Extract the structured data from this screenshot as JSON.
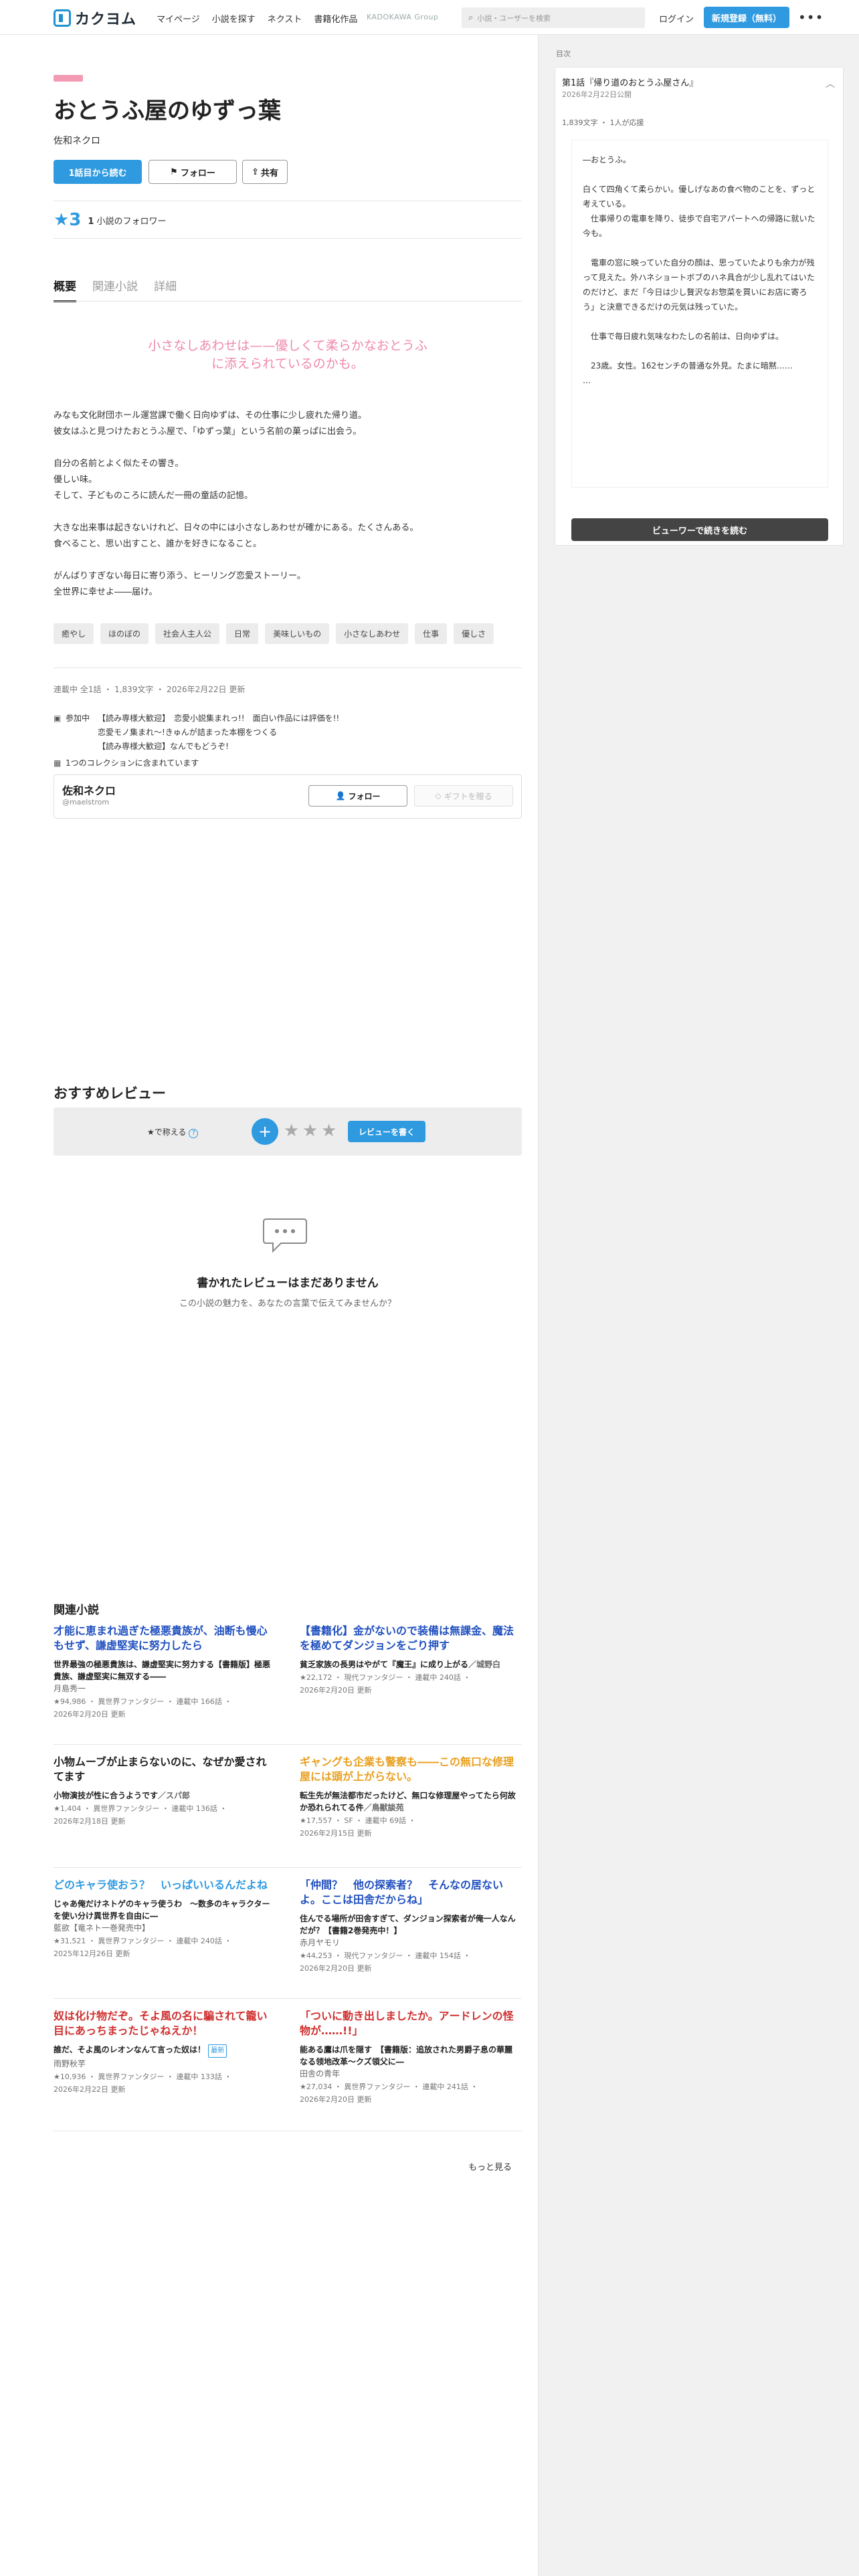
{
  "header": {
    "logo_text": "カクヨム",
    "nav": [
      "マイページ",
      "小説を探す",
      "ネクスト",
      "書籍化作品"
    ],
    "kadokawa": "KADOKAWA Group",
    "search_placeholder": "小説・ユーザーを検索",
    "login": "ログイン",
    "signup": "新規登録（無料）",
    "more": "•••"
  },
  "work": {
    "title": "おとうふ屋のゆずっ葉",
    "author": "佐和ネクロ",
    "read_btn": "1話目から読む",
    "follow_btn": "フォロー",
    "share_btn": "共有",
    "stars": "★3",
    "follower_count": "1",
    "follower_label": "小説のフォロワー"
  },
  "tabs": [
    "概要",
    "関連小説",
    "詳細"
  ],
  "catch": [
    "小さなしあわせは——優しくて柔らかなおとうふ",
    "に添えられているのかも。"
  ],
  "intro": [
    "みなも文化財団ホール運営課で働く日向ゆずは、その仕事に少し疲れた帰り道。",
    "彼女はふと見つけたおとうふ屋で、「ゆずっ葉」という名前の菓っぱに出会う。",
    "",
    "自分の名前とよく似たその響き。",
    "優しい味。",
    "そして、子どものころに読んだ一冊の童話の記憶。",
    "",
    "大きな出来事は起きないけれど、日々の中には小さなしあわせが確かにある。たくさんある。",
    "食べること、思い出すこと、誰かを好きになること。",
    "",
    "がんばりすぎない毎日に寄り添う、ヒーリング恋愛ストーリー。",
    "全世界に幸せよ――届け。"
  ],
  "tags": [
    "癒やし",
    "ほのぼの",
    "社会人主人公",
    "日常",
    "美味しいもの",
    "小さなしあわせ",
    "仕事",
    "優しさ"
  ],
  "meta": "連載中 全1話 ・ 1,839文字 ・ 2026年2月22日 更新",
  "events": {
    "label": "参加中",
    "items": [
      "【読み専様大歓迎】　恋愛小説集まれっ!!　面白い作品には評価を!!",
      "恋愛モノ集まれ〜!きゅんが詰まった本棚をつくる",
      "【読み専様大歓迎】なんでもどうぞ!"
    ]
  },
  "collection": "1つのコレクションに含まれています",
  "author_box": {
    "name": "佐和ネクロ",
    "id": "@maelstrom",
    "follow": "フォロー",
    "gift": "ギフトを贈る"
  },
  "reviews": {
    "heading": "おすすめレビュー",
    "rate_label": "★で称える",
    "write_btn": "レビューを書く",
    "empty_title": "書かれたレビューはまだありません",
    "empty_sub": "この小説の魅力を、あなたの言葉で伝えてみませんか？"
  },
  "related": {
    "heading": "関連小説",
    "more": "もっと見る",
    "items": [
      {
        "title": "才能に恵まれ過ぎた極悪貴族が、油断も慢心もせず、謙虚堅実に努力したら",
        "color": "#1f4fbf",
        "catch": "世界最強の極悪貴族は、謙虚堅実に努力する【書籍版】極悪貴族、謙虚堅実に無双する――",
        "author": "月島秀一",
        "meta1": "★94,986 ・ 異世界ファンタジー ・ 連載中 166話 ・",
        "meta2": "2026年2月20日 更新",
        "badge": ""
      },
      {
        "title": "【書籍化】金がないので装備は無課金、魔法を極めてダンジョンをごり押す",
        "color": "#1f4fbf",
        "catch": "貧乏家族の長男はやがて『魔王』に成り上がる",
        "author": "／城野白",
        "meta1": "★22,172 ・ 現代ファンタジー ・ 連載中 240話 ・",
        "meta2": "2026年2月20日 更新",
        "badge": ""
      },
      {
        "title": "小物ムーブが止まらないのに、なぜか愛されてます",
        "color": "#222222",
        "catch": "小物演技が性に合うようです",
        "author": "／スパ郎",
        "meta1": "★1,404 ・ 異世界ファンタジー ・ 連載中 136話 ・",
        "meta2": "2026年2月18日 更新",
        "badge": ""
      },
      {
        "title": "ギャングも企業も警察も――この無口な修理屋には頭が上がらない。",
        "color": "#e8a020",
        "catch": "転生先が無法都市だったけど、無口な修理屋やってたら何故か恐れられてる件",
        "author": "／鳥獣談苑",
        "meta1": "★17,557 ・ SF ・ 連載中 69話 ・",
        "meta2": "2026年2月15日 更新",
        "badge": ""
      },
      {
        "title": "どのキャラ使おう？　いっぱいいるんだよね",
        "color": "#2f9ae0",
        "catch": "じゃあ俺だけネトゲのキャラ使うわ　〜数多のキャラクターを使い分け異世界を自由に―",
        "author": "藍欲【竜ネト一巻発売中】",
        "meta1": "★31,521 ・ 異世界ファンタジー ・ 連載中 240話 ・",
        "meta2": "2025年12月26日 更新",
        "badge": ""
      },
      {
        "title": "「仲間？　他の探索者？　そんなの居ないよ。ここは田舎だからね」",
        "color": "#1f4fbf",
        "catch": "住んでる場所が田舎すぎて、ダンジョン探索者が俺一人なんだが？【書籍2巻発売中！】",
        "author": "赤月ヤモリ",
        "meta1": "★44,253 ・ 現代ファンタジー ・ 連載中 154話 ・",
        "meta2": "2026年2月20日 更新",
        "badge": ""
      },
      {
        "title": "奴は化け物だぞ。そよ風の名に騙されて籠い目にあっちまったじゃねえか！",
        "color": "#d02f2f",
        "catch": "誰だ、そよ風のレオンなんて言った奴は！",
        "author": "雨野秋芋",
        "meta1": "★10,936 ・ 異世界ファンタジー ・ 連載中 133話 ・",
        "meta2": "2026年2月22日 更新",
        "badge": "最新"
      },
      {
        "title": "「ついに動き出しましたか。アードレンの怪物が……!!」",
        "color": "#d02f2f",
        "catch": "能ある鷹は爪を隠す　【書籍版：追放された男爵子息の華麗なる领地改革〜クズ領父に―",
        "author": "田舎の青年",
        "meta1": "★27,034 ・ 異世界ファンタジー ・ 連載中 241話 ・",
        "meta2": "2026年2月20日 更新",
        "badge": ""
      }
    ]
  },
  "side": {
    "label": "目次",
    "episode": "第1話『帰り道のおとうふ屋さん』",
    "date": "2026年2月22日公開",
    "stats": "1,839文字 ・ 1人が応援",
    "text": [
      "―おとうふ。",
      "",
      "白くて四角くて柔らかい。優しげなあの食べ物のことを、ずっと考えている。",
      "　仕事帰りの電車を降り、徒歩で自宅アパートへの帰路に就いた今も。",
      "",
      "　電車の窓に映っていた自分の顔は、思っていたよりも余力が残って見えた。外ハネショートボブのハネ具合が少し乱れてはいたのだけど、まだ「今日は少し贅沢なお惣菜を買いにお店に寄ろう」と決意できるだけの元気は残っていた。",
      "",
      "　仕事で毎日疲れ気味なわたしの名前は、日向ゆずは。",
      "",
      "　23歳。女性。162センチの普通な外見。たまに暗黙……",
      "…"
    ],
    "viewer_btn": "ビューワーで続きを読む"
  }
}
